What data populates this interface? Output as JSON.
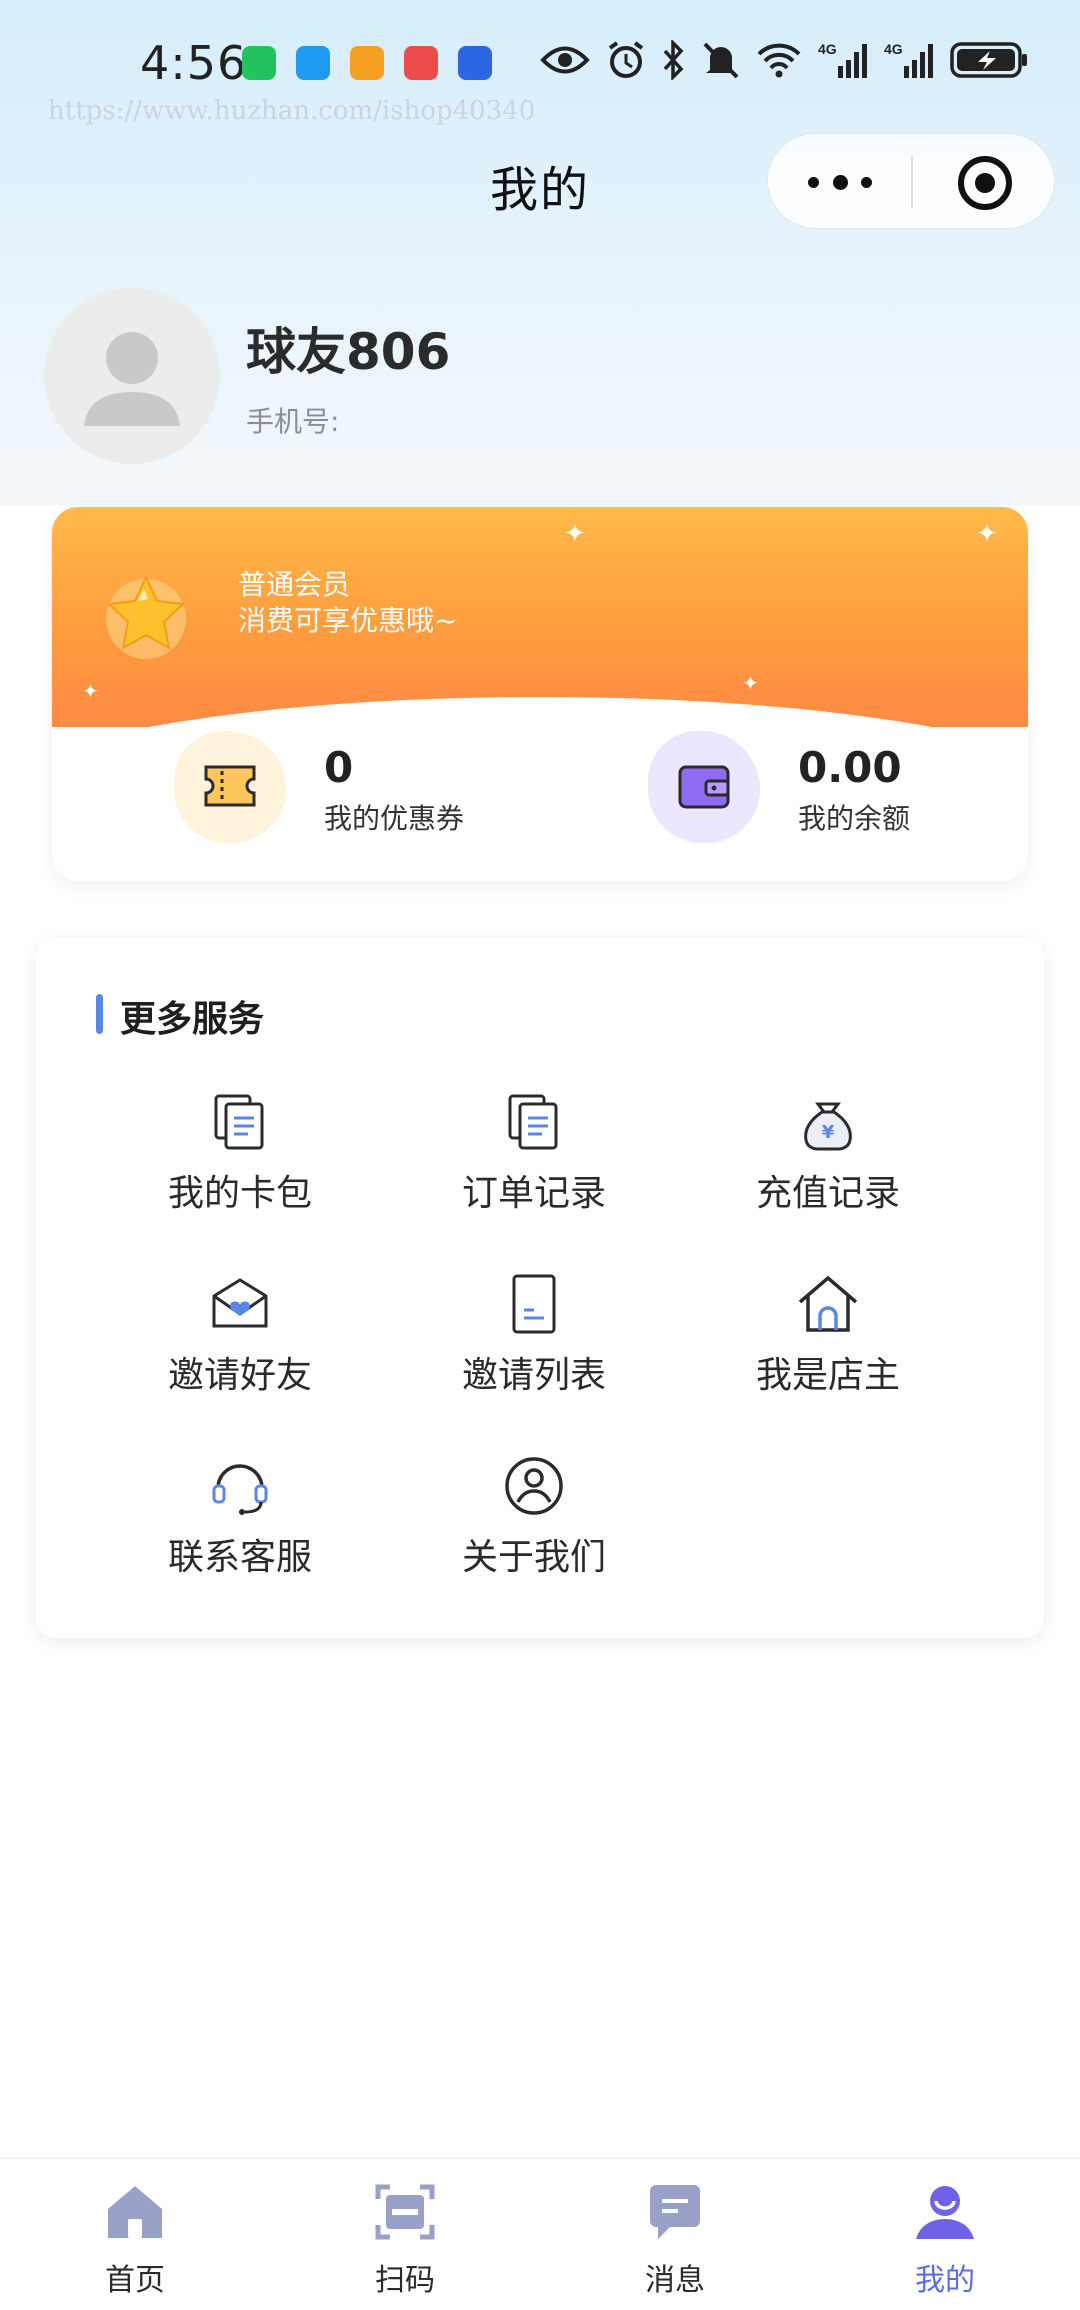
{
  "status_bar": {
    "time": "4:56",
    "watermark": "https://www.huzhan.com/ishop40340",
    "app_icons": [
      "wechat-icon",
      "message-icon",
      "orange-app-icon",
      "red-app-icon",
      "bulb-app-icon"
    ],
    "system_icons": [
      "eye-icon",
      "alarm-icon",
      "bluetooth-icon",
      "bell-off-icon",
      "wifi-icon",
      "signal-4g-icon",
      "signal-4g-icon",
      "battery-charging-icon"
    ]
  },
  "nav": {
    "title": "我的",
    "capsule": {
      "more_icon": "more-dots-icon",
      "close_icon": "target-circle-icon"
    }
  },
  "profile": {
    "name": "球友806",
    "phone_label": "手机号:"
  },
  "member": {
    "level": "普通会员",
    "desc": "消费可享优惠哦~",
    "coupon_value": "0",
    "coupon_label": "我的优惠券",
    "balance_value": "0.00",
    "balance_label": "我的余额"
  },
  "services": {
    "title": "更多服务",
    "items": [
      {
        "label": "我的卡包",
        "icon": "card-pack-icon"
      },
      {
        "label": "订单记录",
        "icon": "order-record-icon"
      },
      {
        "label": "充值记录",
        "icon": "money-bag-icon"
      },
      {
        "label": "邀请好友",
        "icon": "invite-envelope-icon"
      },
      {
        "label": "邀请列表",
        "icon": "invite-list-icon"
      },
      {
        "label": "我是店主",
        "icon": "shop-house-icon"
      },
      {
        "label": "联系客服",
        "icon": "headset-icon"
      },
      {
        "label": "关于我们",
        "icon": "user-circle-icon"
      }
    ]
  },
  "tabs": [
    {
      "label": "首页",
      "icon": "home-icon"
    },
    {
      "label": "扫码",
      "icon": "scan-icon"
    },
    {
      "label": "消息",
      "icon": "message-icon"
    },
    {
      "label": "我的",
      "icon": "profile-icon",
      "active": true
    }
  ],
  "colors": {
    "accent": "#5a6ee0",
    "section_bar": "#5a86e8",
    "member_gradient_top": "#ffba48",
    "member_gradient_bottom": "#ff8a46",
    "icon_gray": "#9aa1c9"
  }
}
